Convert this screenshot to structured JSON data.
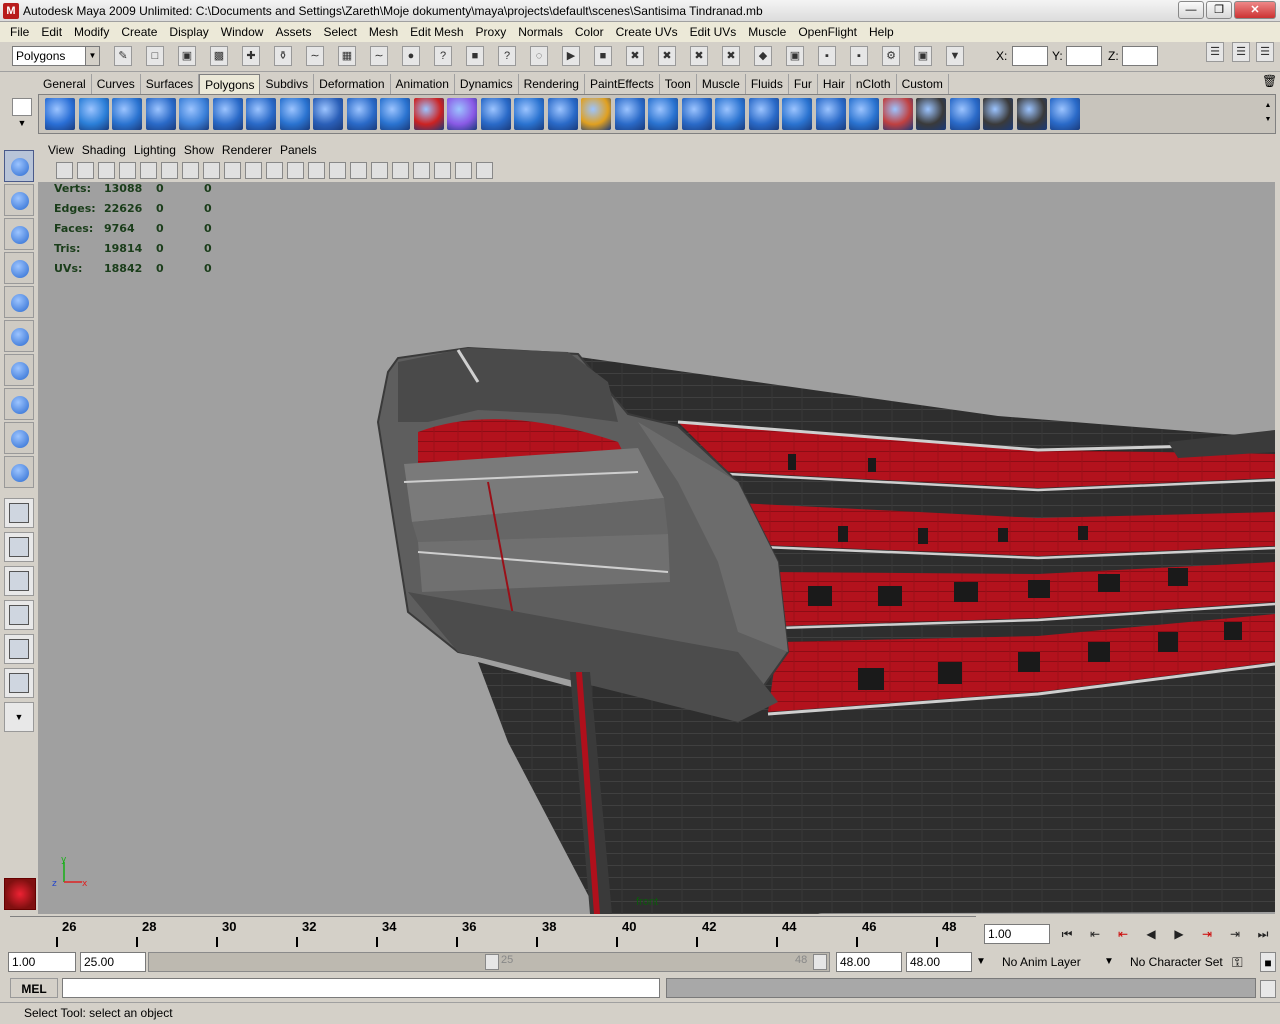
{
  "window": {
    "title": "Autodesk Maya 2009 Unlimited: C:\\Documents and Settings\\Zareth\\Moje dokumenty\\maya\\projects\\default\\scenes\\Santisima Tindranad.mb",
    "icon": "maya-logo-icon"
  },
  "menubar": {
    "items": [
      "File",
      "Edit",
      "Modify",
      "Create",
      "Display",
      "Window",
      "Assets",
      "Select",
      "Mesh",
      "Edit Mesh",
      "Proxy",
      "Normals",
      "Color",
      "Create UVs",
      "Edit UVs",
      "Muscle",
      "OpenFlight",
      "Help"
    ]
  },
  "statusline": {
    "mode": "Polygons",
    "x_label": "X:",
    "y_label": "Y:",
    "z_label": "Z:"
  },
  "shelf": {
    "tabs": [
      "General",
      "Curves",
      "Surfaces",
      "Polygons",
      "Subdivs",
      "Deformation",
      "Animation",
      "Dynamics",
      "Rendering",
      "PaintEffects",
      "Toon",
      "Muscle",
      "Fluids",
      "Fur",
      "Hair",
      "nCloth",
      "Custom"
    ],
    "active_tab": "Polygons"
  },
  "panel": {
    "menu": [
      "View",
      "Shading",
      "Lighting",
      "Show",
      "Renderer",
      "Panels"
    ],
    "camera": "front"
  },
  "hud": {
    "rows": [
      {
        "label": "Verts:",
        "v1": "13088",
        "v2": "0",
        "v3": "0"
      },
      {
        "label": "Edges:",
        "v1": "22626",
        "v2": "0",
        "v3": "0"
      },
      {
        "label": "Faces:",
        "v1": "9764",
        "v2": "0",
        "v3": "0"
      },
      {
        "label": "Tris:",
        "v1": "19814",
        "v2": "0",
        "v3": "0"
      },
      {
        "label": "UVs:",
        "v1": "18842",
        "v2": "0",
        "v3": "0"
      }
    ]
  },
  "timeline": {
    "ticks": [
      "26",
      "28",
      "30",
      "32",
      "34",
      "36",
      "38",
      "40",
      "42",
      "44",
      "46",
      "48"
    ],
    "current_time": "1.00"
  },
  "range": {
    "start": "1.00",
    "playback_start": "25.00",
    "slider_left": "25",
    "slider_right": "48",
    "playback_end": "48.00",
    "end": "48.00",
    "anim_layer": "No Anim Layer",
    "character_set": "No Character Set"
  },
  "commandline": {
    "label": "MEL"
  },
  "helpline": {
    "text": "Select Tool: select an object"
  },
  "colors": {
    "viewport_bg": "#a0a0a0",
    "hull_dark": "#2b2b2b",
    "hull_red": "#b0101c",
    "stern_gray": "#5e5e5e"
  }
}
